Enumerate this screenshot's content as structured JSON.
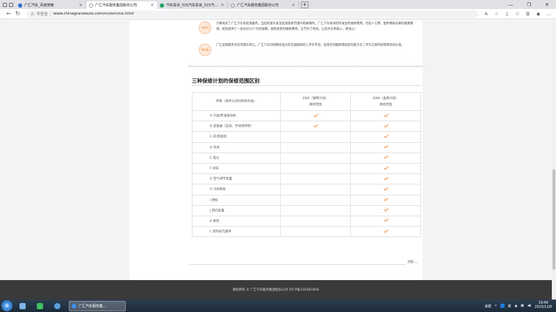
{
  "browser": {
    "tabs": [
      {
        "title": "广汇汽车_百度搜索",
        "favicon_color": "#2f6bd9",
        "active": false
      },
      {
        "title": "广汇汽车服务集团股份公司",
        "favicon_color": "#ffffff",
        "active": true
      },
      {
        "title": "汽车投诉_315汽车投诉_315汽车…",
        "favicon_color": "#1aa260",
        "active": false
      },
      {
        "title": "广汇汽车服务集团股份公司",
        "favicon_color": "#ffffff",
        "active": false
      }
    ],
    "new_tab": "+",
    "address": {
      "security_label": "不安全",
      "url": "www.chinagrandauto.com/cn/service.html"
    }
  },
  "intro": {
    "items": [
      {
        "badge": "省省钱",
        "text": "只要购买了广汇汽车的延保服务，当您的爱车发生延保保修范围内的故障时，广汇汽车将承担所发生的维修费用，包括人工费、配件费和必要的施救费用。给您提供了一份长达12个月的保障，避免昂贵的维修费用，又节约了时间，让您开车更安心、更放心！"
      },
      {
        "badge": "更保值",
        "text": "广汇延保服务合同可随车转让，广汇汽车同时拥有强大的全国联网的二手车平台，延保合同能够增加您的爱车在二手车交易时获得更高的价值。"
      }
    ]
  },
  "section": {
    "title": "三种保修计划的保修范围区别",
    "table": {
      "header_col1": "项目（具体以合同条款为准）",
      "header_col2_line1": "EW2（钢琴计划）",
      "header_col2_line2": "保修范围",
      "header_col3_line1": "EW8（金牌计划）",
      "header_col3_line2": "保修范围",
      "rows": [
        {
          "item": "A  汽油/柴油发动机",
          "ew2": true,
          "ew8": true
        },
        {
          "item": "B  变速器（自动、手动或转移）",
          "ew2": true,
          "ew8": true
        },
        {
          "item": "C  前/后驱动",
          "ew2": false,
          "ew8": true
        },
        {
          "item": "D  壳体",
          "ew2": false,
          "ew8": true
        },
        {
          "item": "E  电力",
          "ew2": false,
          "ew8": true
        },
        {
          "item": "F  刹车",
          "ew2": false,
          "ew8": true
        },
        {
          "item": "G  空气调节装置",
          "ew2": false,
          "ew8": true
        },
        {
          "item": "H  冷却系统",
          "ew2": false,
          "ew8": true
        },
        {
          "item": "I  燃料",
          "ew2": false,
          "ew8": true
        },
        {
          "item": "J  转向装置",
          "ew2": false,
          "ew8": true
        },
        {
          "item": "K  悬架",
          "ew2": false,
          "ew8": true
        },
        {
          "item": "L  高科技元器件",
          "ew2": false,
          "ew8": true
        }
      ]
    }
  },
  "top_link": "顶部 ︿",
  "footer": {
    "text": "版权所有 © 广汇汽车服务集团股份公司 沪ICP备12038246号"
  },
  "taskbar": {
    "task_title": "广汇汽车服务集…",
    "desktop_label": "桌面",
    "lang_label": "库",
    "time": "19:49",
    "date": "2023/12/8"
  },
  "colors": {
    "check": "#f08a3c",
    "footer_bg": "#3a3a3a",
    "badge_border": "#f5c39e"
  }
}
